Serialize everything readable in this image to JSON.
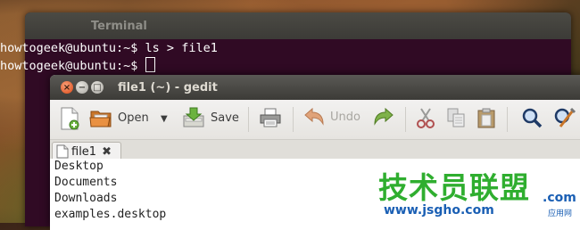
{
  "terminal": {
    "title": "Terminal",
    "lines": [
      "howtogeek@ubuntu:~$ ls > file1",
      "howtogeek@ubuntu:~$ "
    ]
  },
  "gedit": {
    "title": "file1 (~) - gedit",
    "window_controls": {
      "close": "×",
      "minimize": "−",
      "maximize": "□"
    },
    "toolbar": {
      "new_icon": "new-document-icon",
      "open_label": "Open",
      "save_label": "Save",
      "print_icon": "print-icon",
      "undo_label": "Undo",
      "redo_icon": "redo-icon",
      "cut_icon": "cut-icon",
      "copy_icon": "copy-icon",
      "paste_icon": "paste-icon",
      "find_icon": "find-icon",
      "replace_icon": "find-replace-icon"
    },
    "tab": {
      "label": "file1",
      "close": "✖"
    },
    "editor_lines": [
      "Desktop",
      "Documents",
      "Downloads",
      "examples.desktop"
    ]
  },
  "watermark": {
    "chinese": "技术员联盟",
    "url": "www.jsgho.com",
    "com": ".com",
    "sub": "应用网"
  },
  "colors": {
    "terminal_bg": "#300a24",
    "titlebar": "#3c3b37",
    "close_button": "#dd4814",
    "watermark_green": "#2fae2f",
    "watermark_blue": "#1a5fb4"
  }
}
